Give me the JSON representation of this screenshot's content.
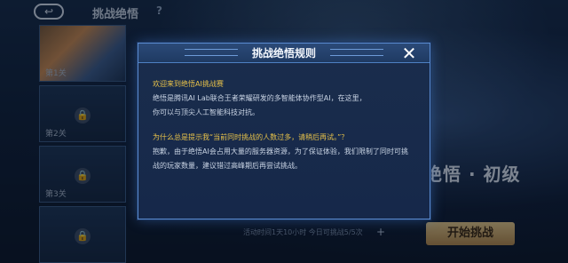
{
  "header": {
    "back_label": "↩",
    "title": "挑战绝悟",
    "help_label": "?"
  },
  "stages": [
    {
      "label": "第1关",
      "locked": false
    },
    {
      "label": "第2关",
      "locked": true
    },
    {
      "label": "第3关",
      "locked": true
    },
    {
      "label": "",
      "locked": true
    }
  ],
  "background": {
    "art_title": "绝悟 · 初级",
    "bottom_info": "活动时间1天10小时 今日可挑战5/5次",
    "plus_label": "+",
    "start_button": "开始挑战"
  },
  "modal": {
    "title": "挑战绝悟规则",
    "close_label": "✕",
    "welcome": "欢迎来到绝悟AI挑战赛",
    "intro_line1": "绝悟是腾讯AI Lab联合王者荣耀研发的多智能体协作型AI，在这里，",
    "intro_line2": "你可以与顶尖人工智能科技对抗。",
    "question": "为什么总是提示我“当前同时挑战的人数过多，请稍后再试。”？",
    "answer_line1": "抱歉，由于绝悟AI会占用大量的服务器资源，为了保证体验，我们限制了同时可挑",
    "answer_line2": "战的玩家数量，建议错过高峰期后再尝试挑战。"
  },
  "colors": {
    "accent_gold": "#e8c24a",
    "modal_border": "#5a8bd0",
    "modal_bg": "#1a2d4c"
  },
  "icons": [
    "back-arrow-icon",
    "help-icon",
    "lock-icon",
    "close-icon",
    "plus-icon"
  ]
}
